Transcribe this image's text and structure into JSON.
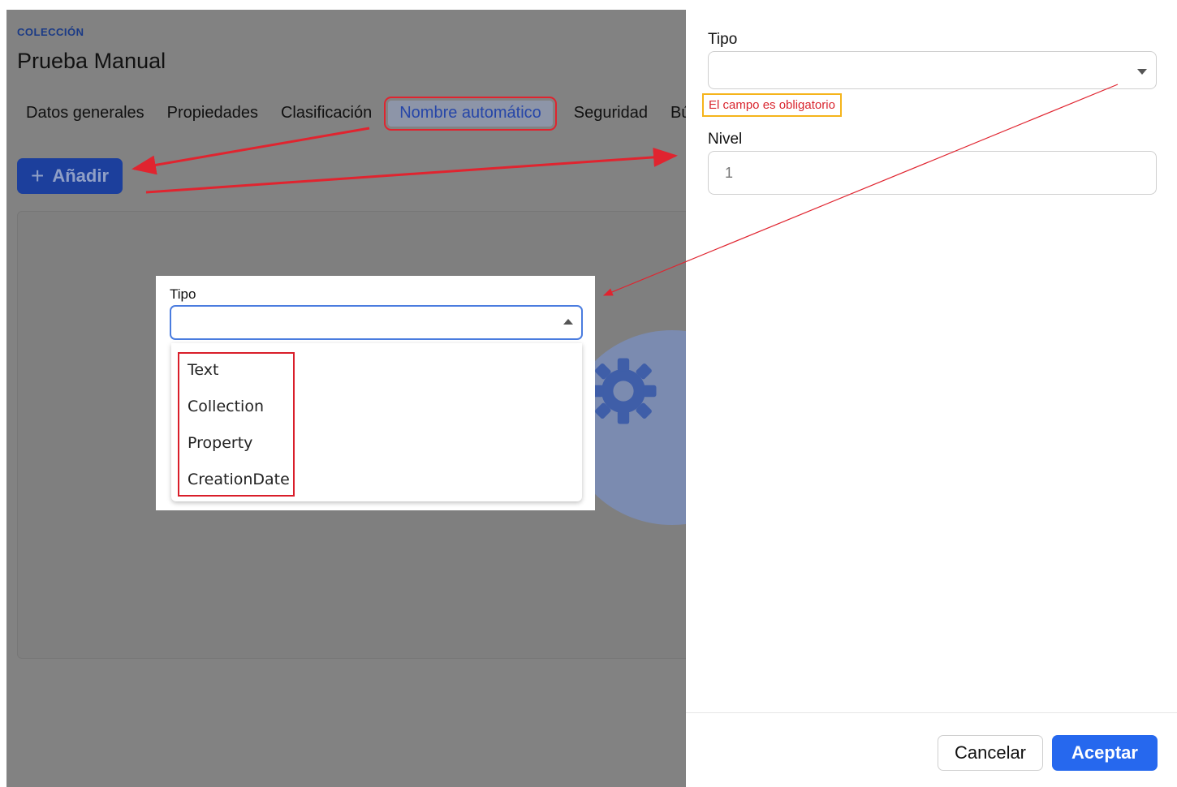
{
  "background_page": {
    "eyebrow": "COLECCIÓN",
    "title": "Prueba Manual",
    "tabs": [
      {
        "label": "Datos generales",
        "active": false
      },
      {
        "label": "Propiedades",
        "active": false
      },
      {
        "label": "Clasificación",
        "active": false
      },
      {
        "label": "Nombre automático",
        "active": true
      },
      {
        "label": "Seguridad",
        "active": false
      },
      {
        "label": "Bús",
        "active": false
      }
    ],
    "add_button": {
      "icon": "plus-icon",
      "label": "Añadir"
    }
  },
  "inset_dropdown": {
    "label": "Tipo",
    "value": "",
    "options": [
      "Text",
      "Collection",
      "Property",
      "CreationDate"
    ]
  },
  "drawer": {
    "tipo": {
      "label": "Tipo",
      "value": "",
      "error": "El campo es obligatorio"
    },
    "nivel": {
      "label": "Nivel",
      "value": "1"
    },
    "cancel_label": "Cancelar",
    "accept_label": "Aceptar"
  },
  "colors": {
    "annotation_red": "#e0242f",
    "annotation_yellow": "#f5b41b",
    "primary": "#2668ee",
    "error_text": "#d9262f"
  }
}
